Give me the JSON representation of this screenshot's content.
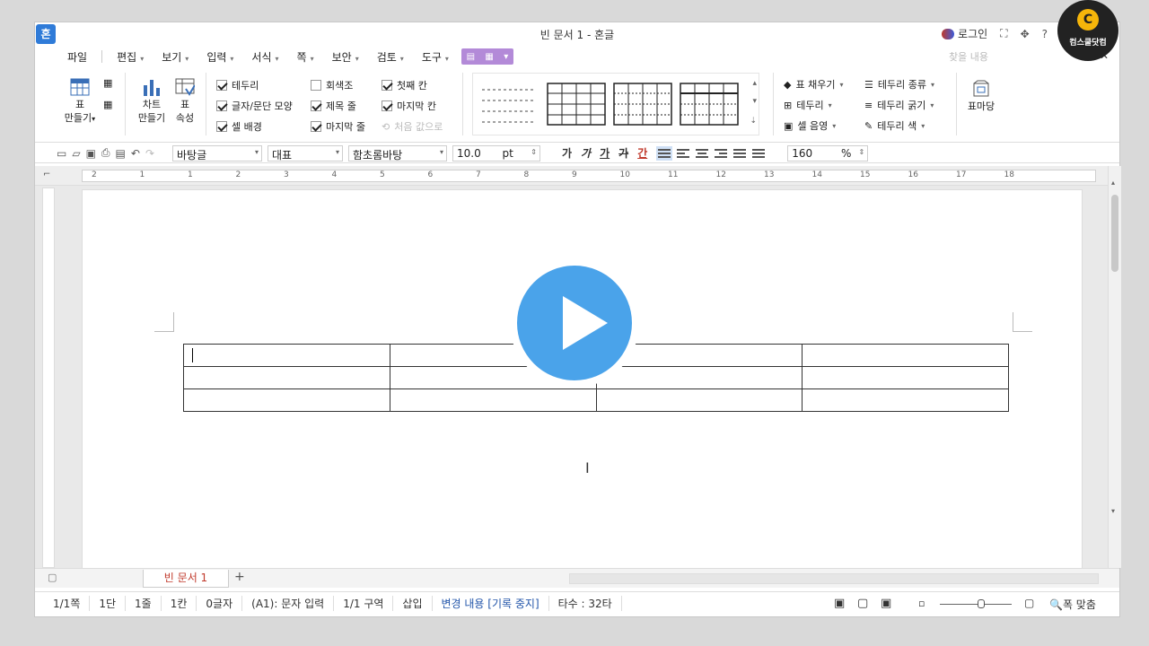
{
  "window": {
    "title": "빈 문서 1 - 혼글",
    "app_icon_label": "혼",
    "login_label": "로그인",
    "help_label": "?",
    "close_label": "✕",
    "help_search_placeholder": "찾을 내용"
  },
  "menus": [
    "파일",
    "편집",
    "보기",
    "입력",
    "서식",
    "쪽",
    "보안",
    "검토",
    "도구"
  ],
  "ribbon": {
    "make_table": "표\n만들기",
    "make_table_l1": "표",
    "make_table_l2": "만들기",
    "chart_l1": "차트",
    "chart_l2": "만들기",
    "props_l1": "표",
    "props_l2": "속성",
    "checks": [
      {
        "label": "테두리",
        "checked": true
      },
      {
        "label": "글자/문단 모양",
        "checked": true
      },
      {
        "label": "셀 배경",
        "checked": true
      },
      {
        "label": "회색조",
        "checked": false
      },
      {
        "label": "제목 줄",
        "checked": true
      },
      {
        "label": "마지막 줄",
        "checked": true
      },
      {
        "label": "첫째 칸",
        "checked": true
      },
      {
        "label": "마지막 칸",
        "checked": true
      },
      {
        "label": "처음 값으로",
        "checked": false,
        "disabled": true
      }
    ],
    "right_tools": [
      "표 채우기",
      "테두리",
      "셀 음영",
      "테두리 종류",
      "테두리 굵기",
      "테두리 색"
    ],
    "table_madang": "표마당"
  },
  "toolbar": {
    "style": "바탕글",
    "para": "대표",
    "font": "함초롬바탕",
    "size": "10.0",
    "unit": "pt",
    "zoom": "160",
    "zoom_unit": "%",
    "fmt": [
      "가",
      "가",
      "가",
      "가",
      "간"
    ]
  },
  "ruler": [
    "2",
    "1",
    "1",
    "2",
    "3",
    "4",
    "5",
    "6",
    "7",
    "8",
    "9",
    "10",
    "11",
    "12",
    "13",
    "14",
    "15",
    "16",
    "17",
    "18"
  ],
  "tabs": {
    "doc": "빈 문서 1",
    "add": "+"
  },
  "status": [
    "1/1쪽",
    "1단",
    "1줄",
    "1칸",
    "0글자",
    "(A1): 문자 입력",
    "1/1 구역",
    "삽입",
    "변경 내용 [기록 중지]",
    "타수 : 32타"
  ],
  "status_zoom": "폭 맞춤",
  "brand": {
    "text": "컴스쿨닷컴",
    "logo": "C"
  },
  "colors": {
    "accent": "#4aa3ea",
    "menu_highlight": "#b38ad8",
    "tab_text": "#c0392b"
  }
}
